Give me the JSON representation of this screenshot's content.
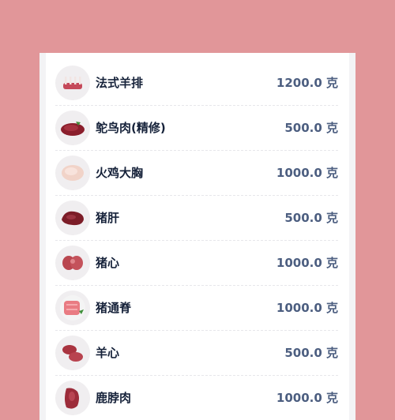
{
  "items": [
    {
      "name": "法式羊排",
      "qty": "1200.0 克",
      "icon": "lamb-rack-icon",
      "color": "#c5495a"
    },
    {
      "name": "鸵鸟肉(精修)",
      "qty": "500.0 克",
      "icon": "ostrich-meat-icon",
      "color": "#8a1e2c"
    },
    {
      "name": "火鸡大胸",
      "qty": "1000.0 克",
      "icon": "turkey-breast-icon",
      "color": "#f1d3c8"
    },
    {
      "name": "猪肝",
      "qty": "500.0 克",
      "icon": "pork-liver-icon",
      "color": "#7c1d28"
    },
    {
      "name": "猪心",
      "qty": "1000.0 克",
      "icon": "pork-heart-icon",
      "color": "#b9464f"
    },
    {
      "name": "猪通脊",
      "qty": "1000.0 克",
      "icon": "pork-loin-icon",
      "color": "#e97b82"
    },
    {
      "name": "羊心",
      "qty": "500.0 克",
      "icon": "lamb-heart-icon",
      "color": "#a93440"
    },
    {
      "name": "鹿脖肉",
      "qty": "1000.0 克",
      "icon": "venison-neck-icon",
      "color": "#9c2c3a"
    }
  ]
}
